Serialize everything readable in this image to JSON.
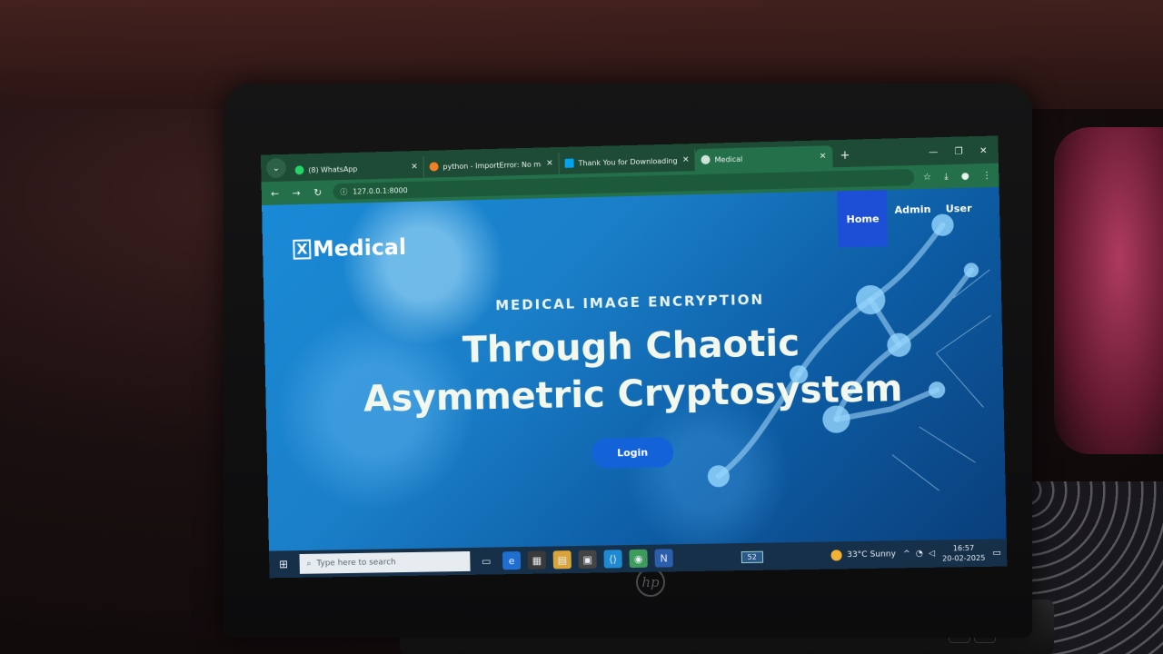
{
  "browser": {
    "tabs": [
      {
        "title": "(8) WhatsApp",
        "favicon": "whatsapp-icon",
        "color": "#25d366"
      },
      {
        "title": "python - ImportError: No modu",
        "favicon": "stackoverflow-icon",
        "color": "#f48024"
      },
      {
        "title": "Thank You for Downloading Vi",
        "favicon": "microsoft-icon",
        "color": "#00a4ef"
      },
      {
        "title": "Medical",
        "favicon": "globe-icon",
        "color": "#cfe3d8"
      }
    ],
    "active_tab": 3,
    "address": "127.0.0.1:8000"
  },
  "site": {
    "logo_mark": "X",
    "logo_text": "Medical",
    "nav": [
      "Home",
      "Admin",
      "User"
    ],
    "active_nav": 0,
    "hero_subtitle": "MEDICAL IMAGE ENCRYPTION",
    "hero_title_line1": "Through Chaotic",
    "hero_title_line2": "Asymmetric Cryptosystem",
    "login_label": "Login"
  },
  "taskbar": {
    "search_placeholder": "Type here to search",
    "badge": "52",
    "weather": "33°C  Sunny",
    "time": "16:57",
    "date": "20-02-2025"
  },
  "colors": {
    "browser_frame": "#1e4b35",
    "nav_active": "#1d4fd6",
    "login_button": "#1462d8"
  }
}
